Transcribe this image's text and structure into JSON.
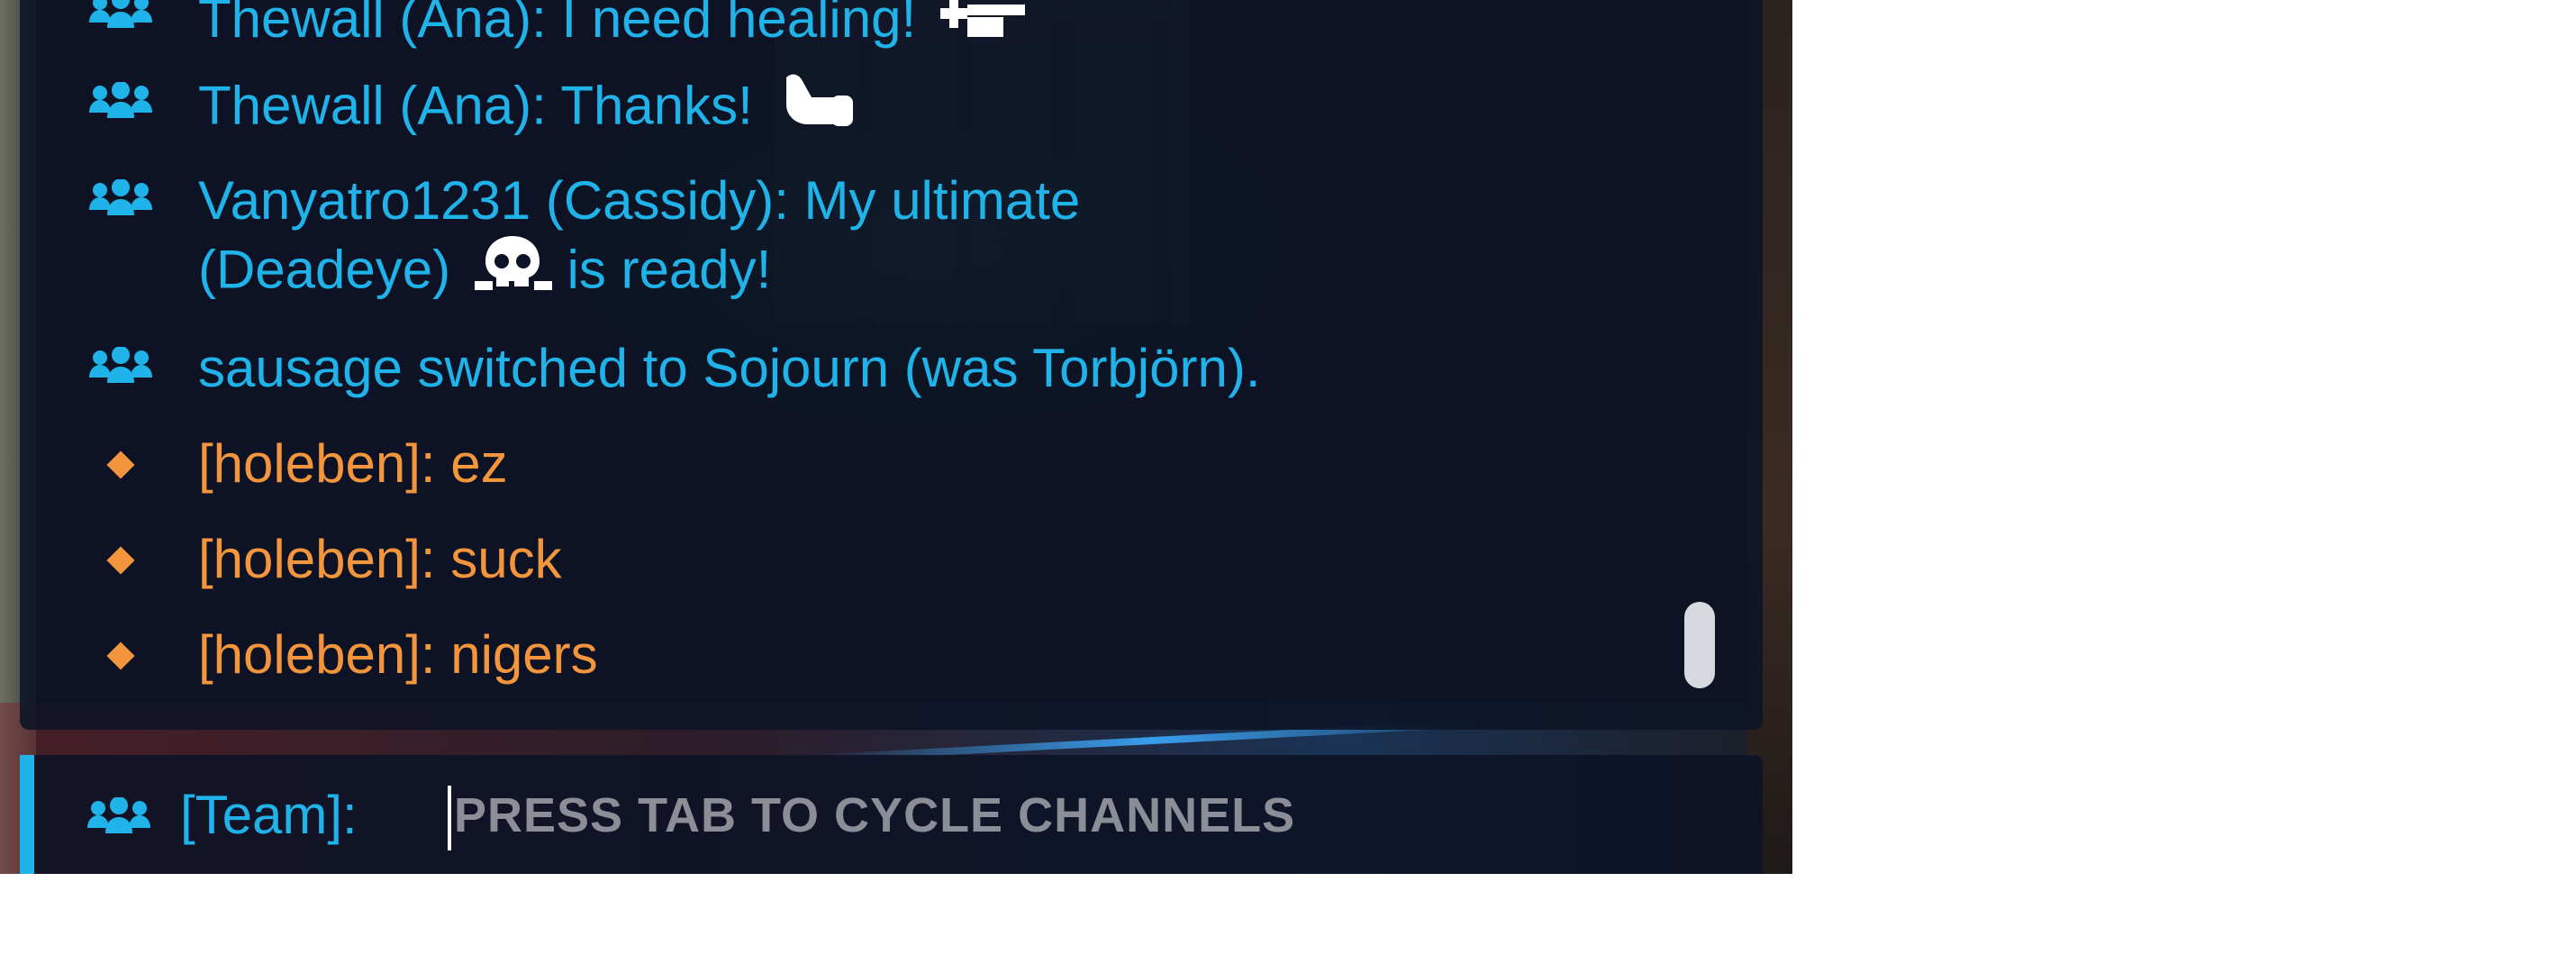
{
  "chat": {
    "messages": [
      {
        "channel": "team",
        "icon": "team-icon",
        "lines": [
          "Thewall (Ana): I need healing!"
        ],
        "emote": "hand-pointing-icon"
      },
      {
        "channel": "team",
        "icon": "team-icon",
        "lines": [
          "Thewall (Ana): Thanks!"
        ],
        "emote": "thumbs-up-icon"
      },
      {
        "channel": "team",
        "icon": "team-icon",
        "lines": [
          "Vanyatro1231 (Cassidy): My ultimate",
          "(Deadeye)",
          "is ready!"
        ],
        "emote": "skull-icon"
      },
      {
        "channel": "team",
        "icon": "team-icon",
        "lines": [
          "sausage switched to Sojourn (was Torbjörn)."
        ]
      },
      {
        "channel": "match",
        "icon": "match-diamond-icon",
        "lines": [
          "[holeben]: ez"
        ]
      },
      {
        "channel": "match",
        "icon": "match-diamond-icon",
        "lines": [
          "[holeben]: suck"
        ]
      },
      {
        "channel": "match",
        "icon": "match-diamond-icon",
        "lines": [
          "[holeben]: nigers"
        ]
      }
    ]
  },
  "input": {
    "channel_label": "[Team]:",
    "placeholder": "PRESS TAB TO CYCLE CHANNELS",
    "value": ""
  },
  "colors": {
    "team": "#1fb3ea",
    "match": "#f2953c",
    "panel": "#0d1326"
  }
}
